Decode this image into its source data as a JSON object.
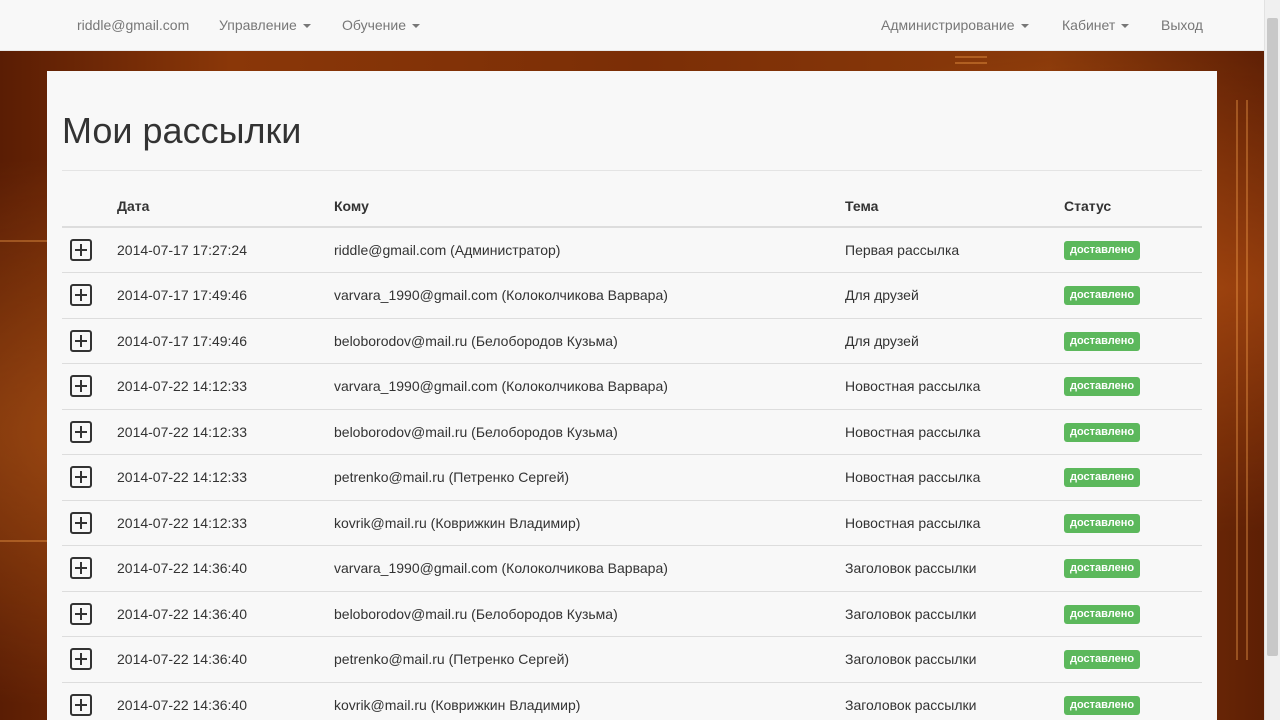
{
  "colors": {
    "navbar_bg": "#f8f8f8",
    "nav_text": "#777777",
    "status_success": "#5cb85c",
    "text": "#333333"
  },
  "navbar": {
    "user": "riddle@gmail.com",
    "management": "Управление",
    "learning": "Обучение",
    "admin": "Администрирование",
    "cabinet": "Кабинет",
    "logout": "Выход"
  },
  "page": {
    "title": "Мои рассылки"
  },
  "table": {
    "headers": {
      "date": "Дата",
      "to": "Кому",
      "subject": "Тема",
      "status": "Статус"
    },
    "row_icon": "expand-plus-icon",
    "rows": [
      {
        "date": "2014-07-17 17:27:24",
        "to": "riddle@gmail.com (Администратор)",
        "subject": "Первая рассылка",
        "status": "доставлено"
      },
      {
        "date": "2014-07-17 17:49:46",
        "to": "varvara_1990@gmail.com (Колоколчикова Варвара)",
        "subject": "Для друзей",
        "status": "доставлено"
      },
      {
        "date": "2014-07-17 17:49:46",
        "to": "beloborodov@mail.ru (Белобородов Кузьма)",
        "subject": "Для друзей",
        "status": "доставлено"
      },
      {
        "date": "2014-07-22 14:12:33",
        "to": "varvara_1990@gmail.com (Колоколчикова Варвара)",
        "subject": "Новостная рассылка",
        "status": "доставлено"
      },
      {
        "date": "2014-07-22 14:12:33",
        "to": "beloborodov@mail.ru (Белобородов Кузьма)",
        "subject": "Новостная рассылка",
        "status": "доставлено"
      },
      {
        "date": "2014-07-22 14:12:33",
        "to": "petrenko@mail.ru (Петренко Сергей)",
        "subject": "Новостная рассылка",
        "status": "доставлено"
      },
      {
        "date": "2014-07-22 14:12:33",
        "to": "kovrik@mail.ru (Коврижкин Владимир)",
        "subject": "Новостная рассылка",
        "status": "доставлено"
      },
      {
        "date": "2014-07-22 14:36:40",
        "to": "varvara_1990@gmail.com (Колоколчикова Варвара)",
        "subject": "Заголовок рассылки",
        "status": "доставлено"
      },
      {
        "date": "2014-07-22 14:36:40",
        "to": "beloborodov@mail.ru (Белобородов Кузьма)",
        "subject": "Заголовок рассылки",
        "status": "доставлено"
      },
      {
        "date": "2014-07-22 14:36:40",
        "to": "petrenko@mail.ru (Петренко Сергей)",
        "subject": "Заголовок рассылки",
        "status": "доставлено"
      },
      {
        "date": "2014-07-22 14:36:40",
        "to": "kovrik@mail.ru (Коврижкин Владимир)",
        "subject": "Заголовок рассылки",
        "status": "доставлено"
      }
    ]
  }
}
